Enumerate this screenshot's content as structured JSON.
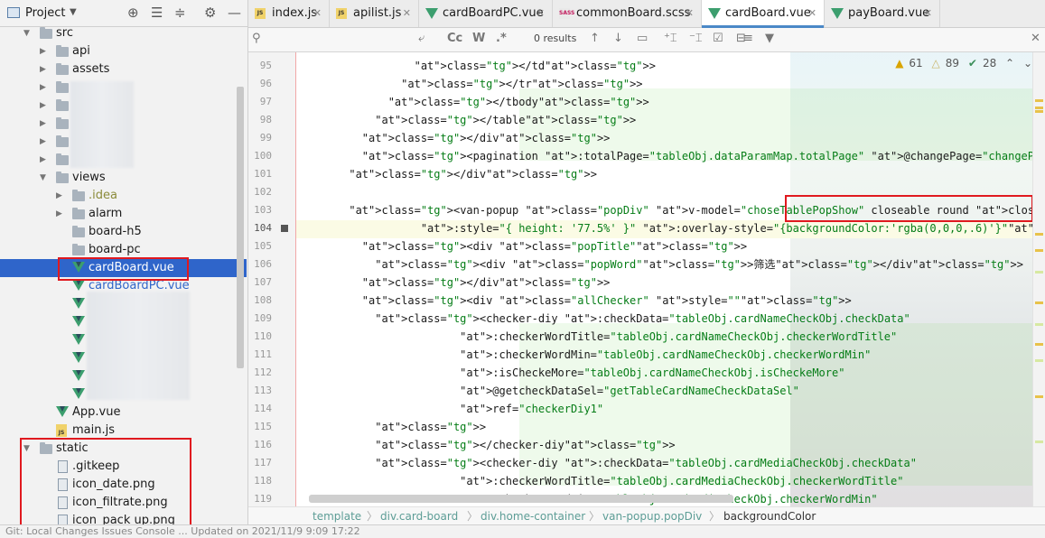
{
  "project": {
    "title": "Project",
    "tree": [
      {
        "label": "src",
        "indent": 1,
        "type": "folder",
        "open": true
      },
      {
        "label": "api",
        "indent": 2,
        "type": "folder"
      },
      {
        "label": "assets",
        "indent": 2,
        "type": "folder"
      },
      {
        "label": "views",
        "indent": 2,
        "type": "folder",
        "open": true
      },
      {
        "label": ".idea",
        "indent": 3,
        "type": "folder"
      },
      {
        "label": "alarm",
        "indent": 3,
        "type": "folder"
      },
      {
        "label": "board-h5",
        "indent": 3,
        "type": "folder"
      },
      {
        "label": "board-pc",
        "indent": 3,
        "type": "folder"
      },
      {
        "label": "cardBoard.vue",
        "indent": 3,
        "type": "vue",
        "selected": true
      },
      {
        "label": "cardBoardPC.vue",
        "indent": 3,
        "type": "vue"
      },
      {
        "label": "App.vue",
        "indent": 2,
        "type": "vue"
      },
      {
        "label": "main.js",
        "indent": 2,
        "type": "js"
      },
      {
        "label": "static",
        "indent": 1,
        "type": "folder",
        "open": true
      },
      {
        "label": ".gitkeep",
        "indent": 2,
        "type": "file"
      },
      {
        "label": "icon_date.png",
        "indent": 2,
        "type": "file"
      },
      {
        "label": "icon_filtrate.png",
        "indent": 2,
        "type": "file"
      },
      {
        "label": "icon_pack up.png",
        "indent": 2,
        "type": "file"
      }
    ]
  },
  "tabs": [
    {
      "label": "index.js",
      "icon": "js-file-icon"
    },
    {
      "label": "apilist.js",
      "icon": "js-file-icon"
    },
    {
      "label": "cardBoardPC.vue",
      "icon": "vue-file-icon"
    },
    {
      "label": "commonBoard.scss",
      "icon": "sass-file-icon"
    },
    {
      "label": "cardBoard.vue",
      "icon": "vue-file-icon",
      "active": true
    },
    {
      "label": "payBoard.vue",
      "icon": "vue-file-icon"
    }
  ],
  "search": {
    "results": "0 results",
    "cc": "Cc",
    "w": "W",
    "regex": ".*"
  },
  "inspections": {
    "warnings": "61",
    "weak": "89",
    "typos": "28"
  },
  "breadcrumbs": [
    "template",
    "div.card-board",
    "div.home-container",
    "van-popup.popDiv",
    "backgroundColor"
  ],
  "status_text": "Git: Local Changes     Issues     Console     ...   Updated on 2021/11/9 9:09 17:22",
  "code": {
    "lines": [
      {
        "n": "95",
        "t": "                </td>"
      },
      {
        "n": "96",
        "t": "              </tr>"
      },
      {
        "n": "97",
        "t": "            </tbody>"
      },
      {
        "n": "98",
        "t": "          </table>"
      },
      {
        "n": "99",
        "t": "        </div>"
      },
      {
        "n": "100",
        "t": "        <pagination :totalPage=\"tableObj.dataParamMap.totalPage\" @changePage=\"changePage\" :page=\"tableObj.dataParamMap"
      },
      {
        "n": "101",
        "t": "      </div>"
      },
      {
        "n": "102",
        "t": ""
      },
      {
        "n": "103",
        "t": "      <van-popup class=\"popDiv\" v-model=\"choseTablePopShow\" closeable round close-icon=\"/static/pop_btn_close.png\" po"
      },
      {
        "n": "104",
        "t": "                 :style=\"{ height: '77.5%' }\" :overlay-style=\"{backgroundColor:'rgba(0,0,0,.6)'}\">"
      },
      {
        "n": "105",
        "t": "        <div class=\"popTitle\">"
      },
      {
        "n": "106",
        "t": "          <div class=\"popWord\">筛选</div>"
      },
      {
        "n": "107",
        "t": "        </div>"
      },
      {
        "n": "108",
        "t": "        <div class=\"allChecker\" style=\"\">"
      },
      {
        "n": "109",
        "t": "          <checker-diy :checkData=\"tableObj.cardNameCheckObj.checkData\""
      },
      {
        "n": "110",
        "t": "                       :checkerWordTitle=\"tableObj.cardNameCheckObj.checkerWordTitle\""
      },
      {
        "n": "111",
        "t": "                       :checkerWordMin=\"tableObj.cardNameCheckObj.checkerWordMin\""
      },
      {
        "n": "112",
        "t": "                       :isCheckeMore=\"tableObj.cardNameCheckObj.isCheckeMore\""
      },
      {
        "n": "113",
        "t": "                       @getcheckDataSel=\"getTableCardNameCheckDataSel\""
      },
      {
        "n": "114",
        "t": "                       ref=\"checkerDiy1\""
      },
      {
        "n": "115",
        "t": "          >"
      },
      {
        "n": "116",
        "t": "          </checker-diy>"
      },
      {
        "n": "117",
        "t": "          <checker-diy :checkData=\"tableObj.cardMediaCheckObj.checkData\""
      },
      {
        "n": "118",
        "t": "                       :checkerWordTitle=\"tableObj.cardMediaCheckObj.checkerWordTitle\""
      },
      {
        "n": "119",
        "t": "                       :checkerWordMin=\"tableObj.cardMediaCheckObj.checkerWordMin\""
      }
    ]
  },
  "colors": {
    "accent": "#2f65ca",
    "highlight": "#e0191f",
    "vue": "#3c9e6e"
  }
}
